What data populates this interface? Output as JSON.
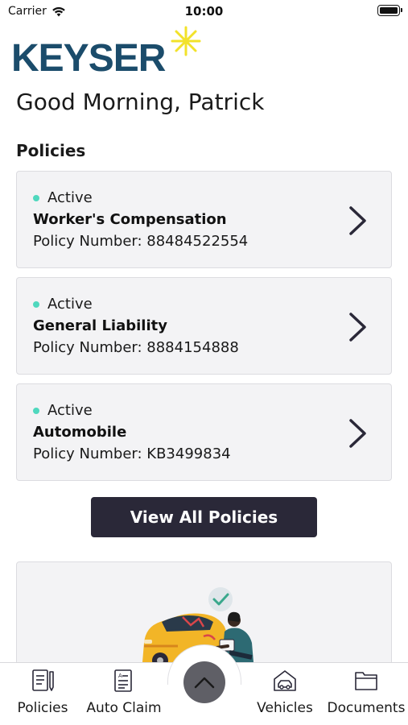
{
  "status_bar": {
    "carrier": "Carrier",
    "time": "10:00"
  },
  "brand": {
    "logo_text": "KEYSER",
    "primary_color": "#1b4c6b",
    "accent_color": "#f2e22a"
  },
  "greeting": "Good Morning, Patrick",
  "policies_section": {
    "title": "Policies",
    "items": [
      {
        "status": "Active",
        "name": "Worker's Compensation",
        "number_label": "Policy Number: 88484522554"
      },
      {
        "status": "Active",
        "name": "General Liability",
        "number_label": "Policy Number: 8884154888"
      },
      {
        "status": "Active",
        "name": "Automobile",
        "number_label": "Policy Number: KB3499834"
      }
    ],
    "status_color": "#4fd8be"
  },
  "view_all_label": "View All Policies",
  "tabbar": {
    "items": [
      {
        "label": "Policies",
        "icon": "policy-document-icon"
      },
      {
        "label": "Auto Claim",
        "icon": "claim-form-icon"
      },
      {
        "label": "Vehicles",
        "icon": "garage-car-icon"
      },
      {
        "label": "Documents",
        "icon": "folder-icon"
      }
    ],
    "center_icon": "chevron-up-icon"
  }
}
